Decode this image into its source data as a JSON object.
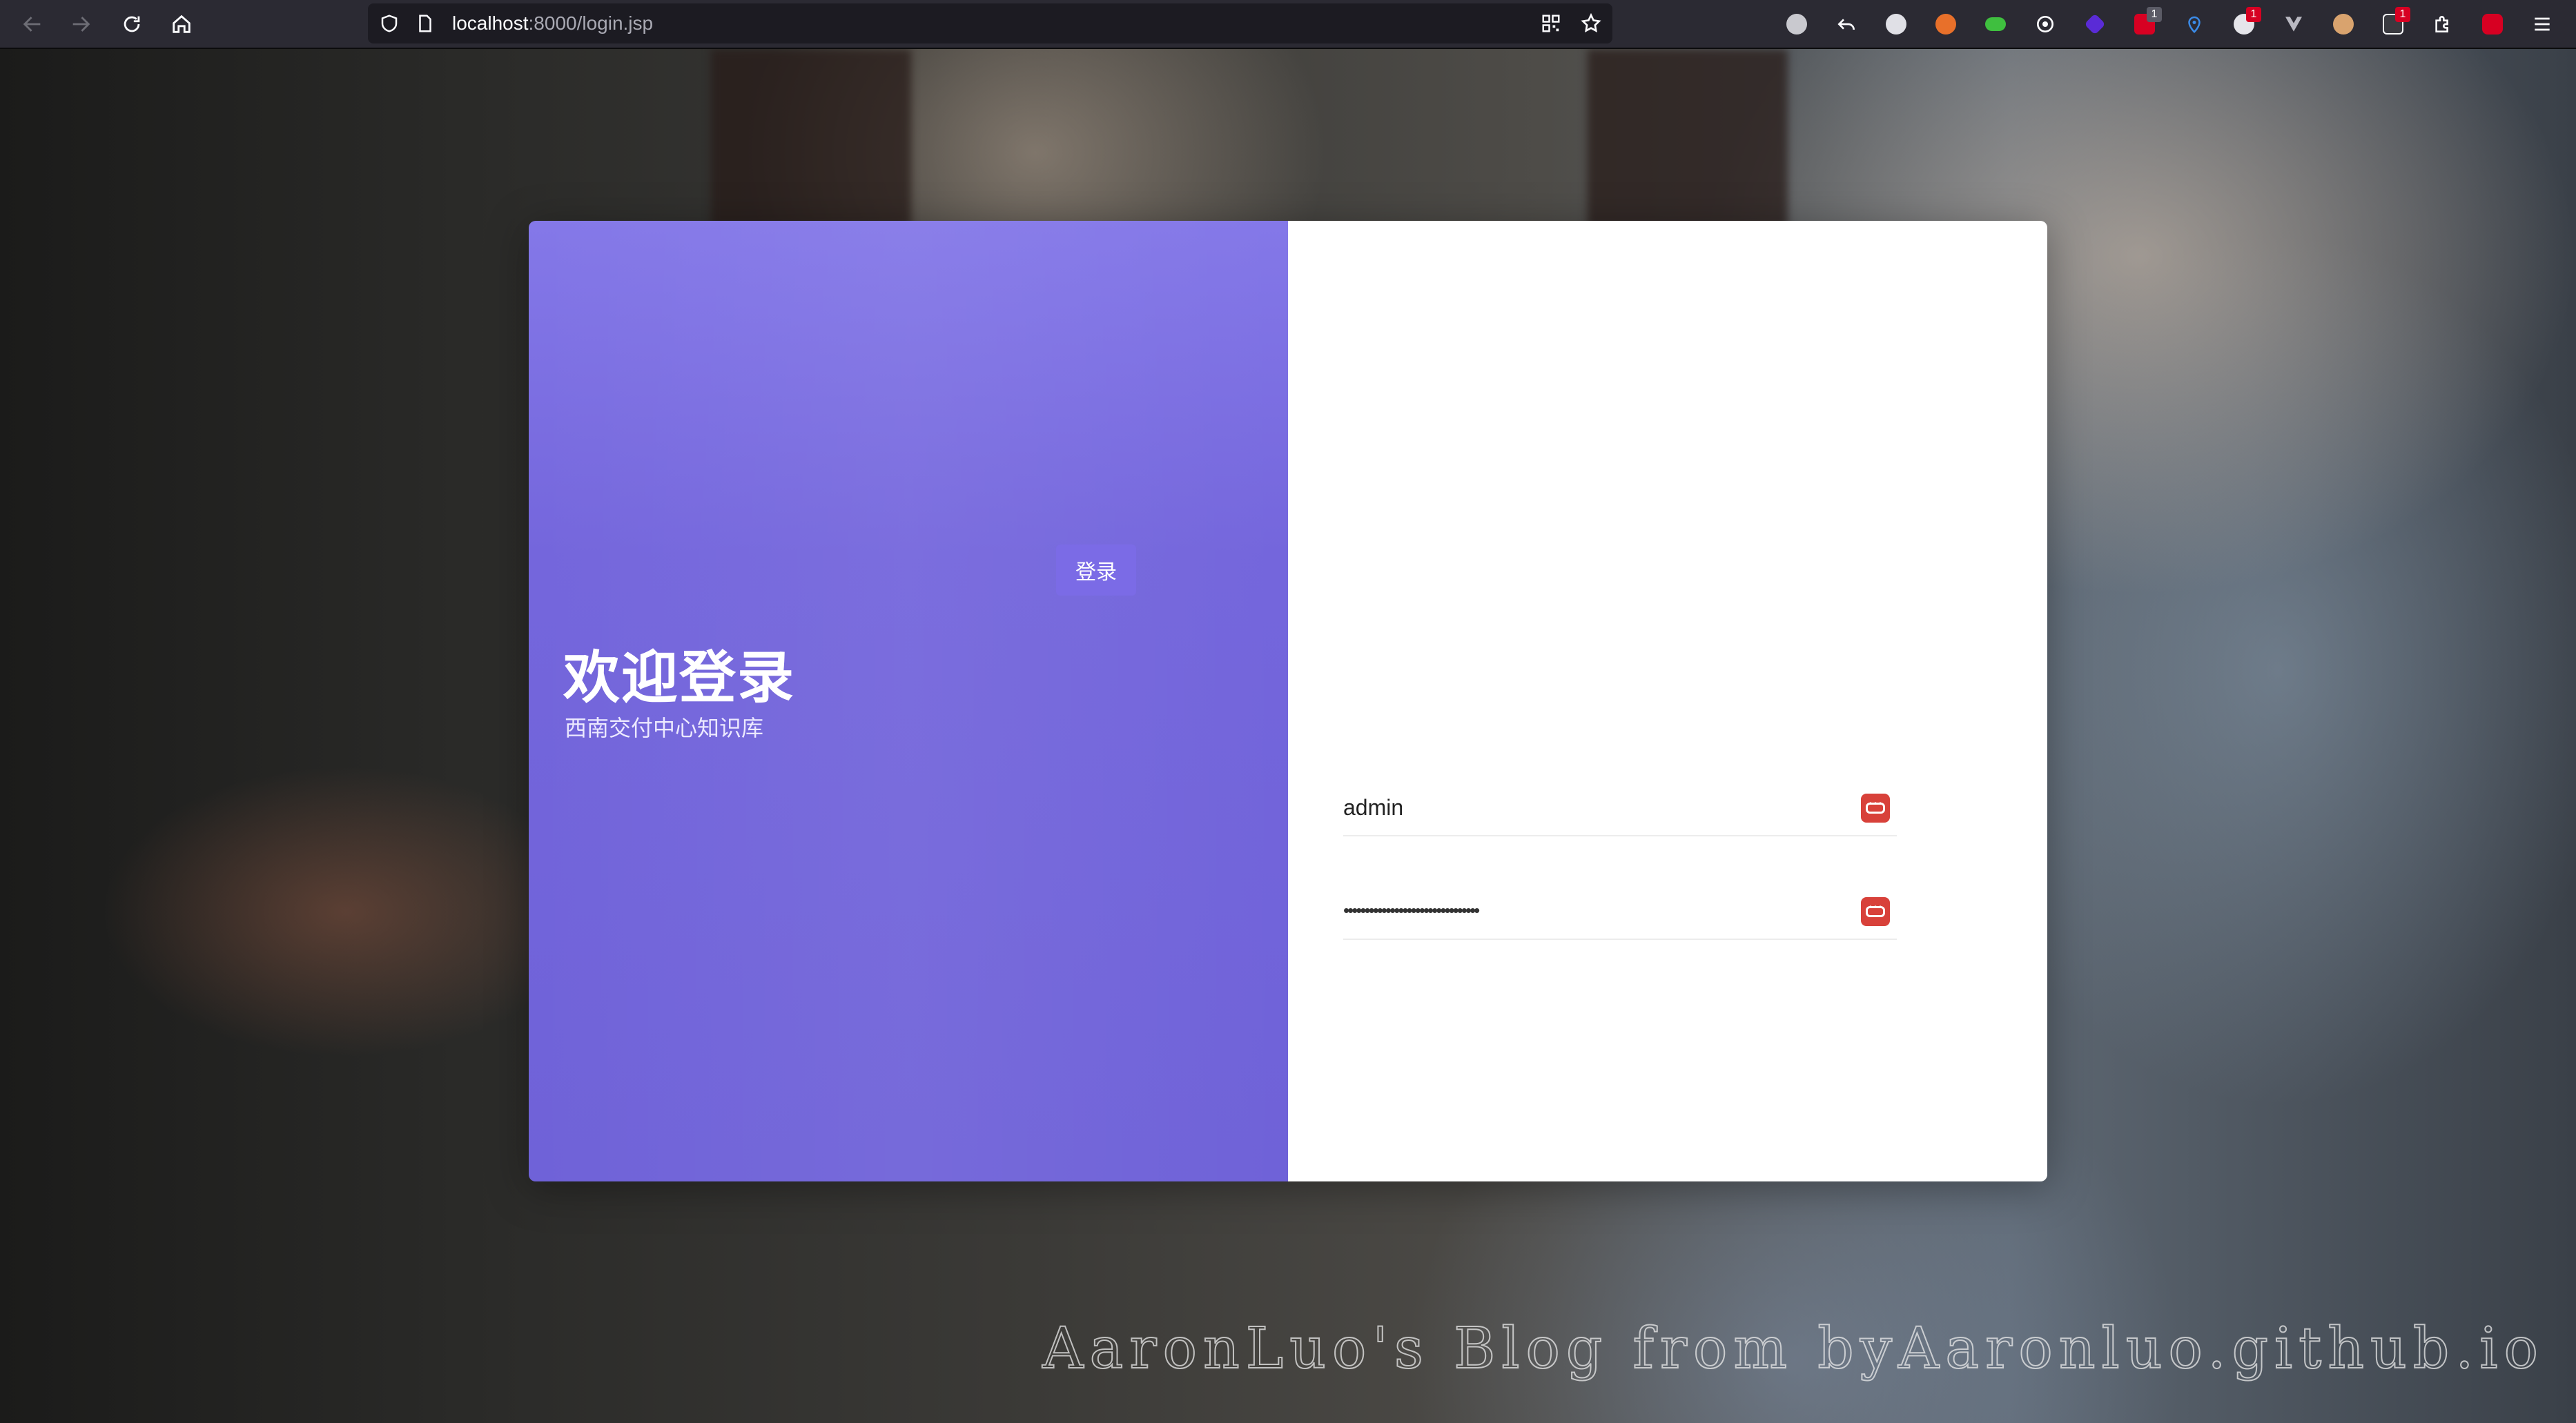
{
  "browser": {
    "url_host": "localhost",
    "url_rest": ":8000/login.jsp",
    "icons": {
      "back": "back-arrow-icon",
      "forward": "forward-arrow-icon",
      "reload": "reload-icon",
      "home": "home-icon",
      "shield": "shield-icon",
      "page": "page-icon",
      "qr": "qr-code-icon",
      "bookmark": "star-icon",
      "menu": "hamburger-menu-icon"
    },
    "extension_badges": {
      "ext_7": "1",
      "ext_10": "1",
      "ext_13": "1"
    }
  },
  "login": {
    "title": "欢迎登录",
    "subtitle": "西南交付中心知识库",
    "username_value": "admin",
    "password_mask": "••••••••••••••••••••••••••••••••",
    "submit_label": "登录"
  },
  "watermark": "AaronLuo's Blog from byAaronluo.github.io",
  "colors": {
    "accent": "#7b6be6",
    "panel": "#7466dc",
    "password_manager": "#d8413a"
  }
}
